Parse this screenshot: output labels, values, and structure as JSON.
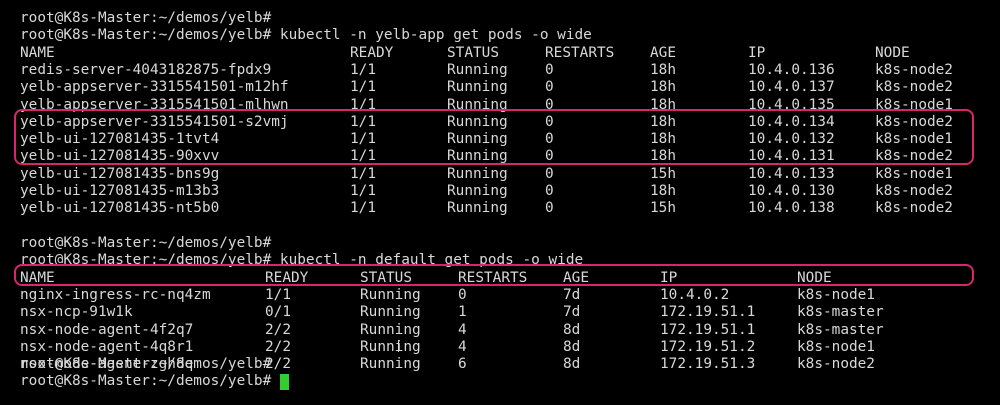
{
  "colors": {
    "background": "#000000",
    "text": "#d8d8d8",
    "highlight_border": "#d8266e",
    "cursor": "#33cc33"
  },
  "terminal": {
    "prompt_1": "root@K8s-Master:~/demos/yelb#",
    "prompt_2": "root@K8s-Master:~/demos/yelb# kubectl -n yelb-app get pods -o wide",
    "yelb_headers": [
      "NAME",
      "READY",
      "STATUS",
      "RESTARTS",
      "AGE",
      "IP",
      "NODE"
    ],
    "yelb_rows": [
      [
        "redis-server-4043182875-fpdx9",
        "1/1",
        "Running",
        "0",
        "18h",
        "10.4.0.136",
        "k8s-node2"
      ],
      [
        "yelb-appserver-3315541501-m12hf",
        "1/1",
        "Running",
        "0",
        "18h",
        "10.4.0.137",
        "k8s-node2"
      ],
      [
        "yelb-appserver-3315541501-mlhwn",
        "1/1",
        "Running",
        "0",
        "18h",
        "10.4.0.135",
        "k8s-node1"
      ],
      [
        "yelb-appserver-3315541501-s2vmj",
        "1/1",
        "Running",
        "0",
        "18h",
        "10.4.0.134",
        "k8s-node2"
      ],
      [
        "yelb-ui-127081435-1tvt4",
        "1/1",
        "Running",
        "0",
        "18h",
        "10.4.0.132",
        "k8s-node1"
      ],
      [
        "yelb-ui-127081435-90xvv",
        "1/1",
        "Running",
        "0",
        "18h",
        "10.4.0.131",
        "k8s-node2"
      ],
      [
        "yelb-ui-127081435-bns9g",
        "1/1",
        "Running",
        "0",
        "15h",
        "10.4.0.133",
        "k8s-node1"
      ],
      [
        "yelb-ui-127081435-m13b3",
        "1/1",
        "Running",
        "0",
        "18h",
        "10.4.0.130",
        "k8s-node2"
      ],
      [
        "yelb-ui-127081435-nt5b0",
        "1/1",
        "Running",
        "0",
        "15h",
        "10.4.0.138",
        "k8s-node2"
      ]
    ],
    "prompt_3": "root@K8s-Master:~/demos/yelb#",
    "prompt_4": "root@K8s-Master:~/demos/yelb# kubectl -n default get pods -o wide",
    "default_headers": [
      "NAME",
      "READY",
      "STATUS",
      "RESTARTS",
      "AGE",
      "IP",
      "NODE"
    ],
    "default_rows": [
      [
        "nginx-ingress-rc-nq4zm",
        "1/1",
        "Running",
        "0",
        "7d",
        "10.4.0.2",
        "k8s-node1"
      ],
      [
        "nsx-ncp-91w1k",
        "0/1",
        "Running",
        "1",
        "7d",
        "172.19.51.1",
        "k8s-master"
      ],
      [
        "nsx-node-agent-4f2q7",
        "2/2",
        "Running",
        "4",
        "8d",
        "172.19.51.1",
        "k8s-master"
      ],
      [
        "nsx-node-agent-4q8r1",
        "2/2",
        "Running",
        "4",
        "8d",
        "172.19.51.2",
        "k8s-node1"
      ],
      [
        "nsx-node-agent-zgh8q",
        "2/2",
        "Running",
        "6",
        "8d",
        "172.19.51.3",
        "k8s-node2"
      ]
    ],
    "prompt_5": "root@K8s-Master:~/demos/yelb#",
    "prompt_6": "root@K8s-Master:~/demos/yelb#"
  }
}
